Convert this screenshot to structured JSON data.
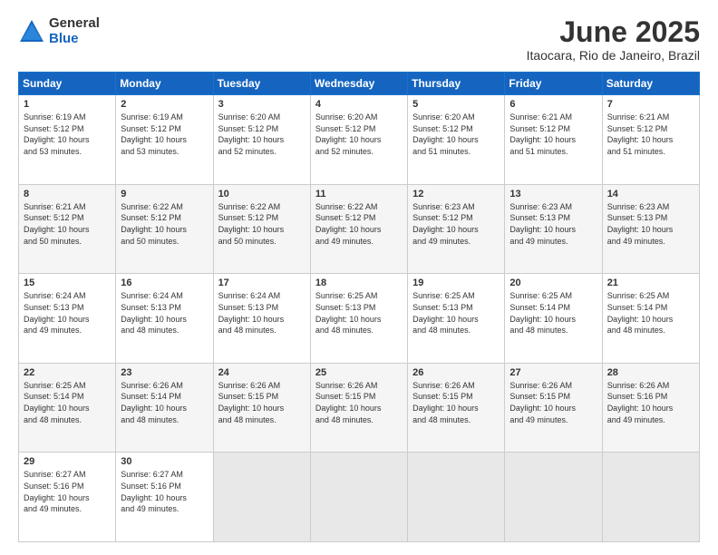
{
  "logo": {
    "general": "General",
    "blue": "Blue"
  },
  "title": "June 2025",
  "location": "Itaocara, Rio de Janeiro, Brazil",
  "days_of_week": [
    "Sunday",
    "Monday",
    "Tuesday",
    "Wednesday",
    "Thursday",
    "Friday",
    "Saturday"
  ],
  "weeks": [
    [
      {
        "day": "1",
        "info": "Sunrise: 6:19 AM\nSunset: 5:12 PM\nDaylight: 10 hours\nand 53 minutes."
      },
      {
        "day": "2",
        "info": "Sunrise: 6:19 AM\nSunset: 5:12 PM\nDaylight: 10 hours\nand 53 minutes."
      },
      {
        "day": "3",
        "info": "Sunrise: 6:20 AM\nSunset: 5:12 PM\nDaylight: 10 hours\nand 52 minutes."
      },
      {
        "day": "4",
        "info": "Sunrise: 6:20 AM\nSunset: 5:12 PM\nDaylight: 10 hours\nand 52 minutes."
      },
      {
        "day": "5",
        "info": "Sunrise: 6:20 AM\nSunset: 5:12 PM\nDaylight: 10 hours\nand 51 minutes."
      },
      {
        "day": "6",
        "info": "Sunrise: 6:21 AM\nSunset: 5:12 PM\nDaylight: 10 hours\nand 51 minutes."
      },
      {
        "day": "7",
        "info": "Sunrise: 6:21 AM\nSunset: 5:12 PM\nDaylight: 10 hours\nand 51 minutes."
      }
    ],
    [
      {
        "day": "8",
        "info": "Sunrise: 6:21 AM\nSunset: 5:12 PM\nDaylight: 10 hours\nand 50 minutes."
      },
      {
        "day": "9",
        "info": "Sunrise: 6:22 AM\nSunset: 5:12 PM\nDaylight: 10 hours\nand 50 minutes."
      },
      {
        "day": "10",
        "info": "Sunrise: 6:22 AM\nSunset: 5:12 PM\nDaylight: 10 hours\nand 50 minutes."
      },
      {
        "day": "11",
        "info": "Sunrise: 6:22 AM\nSunset: 5:12 PM\nDaylight: 10 hours\nand 49 minutes."
      },
      {
        "day": "12",
        "info": "Sunrise: 6:23 AM\nSunset: 5:12 PM\nDaylight: 10 hours\nand 49 minutes."
      },
      {
        "day": "13",
        "info": "Sunrise: 6:23 AM\nSunset: 5:13 PM\nDaylight: 10 hours\nand 49 minutes."
      },
      {
        "day": "14",
        "info": "Sunrise: 6:23 AM\nSunset: 5:13 PM\nDaylight: 10 hours\nand 49 minutes."
      }
    ],
    [
      {
        "day": "15",
        "info": "Sunrise: 6:24 AM\nSunset: 5:13 PM\nDaylight: 10 hours\nand 49 minutes."
      },
      {
        "day": "16",
        "info": "Sunrise: 6:24 AM\nSunset: 5:13 PM\nDaylight: 10 hours\nand 48 minutes."
      },
      {
        "day": "17",
        "info": "Sunrise: 6:24 AM\nSunset: 5:13 PM\nDaylight: 10 hours\nand 48 minutes."
      },
      {
        "day": "18",
        "info": "Sunrise: 6:25 AM\nSunset: 5:13 PM\nDaylight: 10 hours\nand 48 minutes."
      },
      {
        "day": "19",
        "info": "Sunrise: 6:25 AM\nSunset: 5:13 PM\nDaylight: 10 hours\nand 48 minutes."
      },
      {
        "day": "20",
        "info": "Sunrise: 6:25 AM\nSunset: 5:14 PM\nDaylight: 10 hours\nand 48 minutes."
      },
      {
        "day": "21",
        "info": "Sunrise: 6:25 AM\nSunset: 5:14 PM\nDaylight: 10 hours\nand 48 minutes."
      }
    ],
    [
      {
        "day": "22",
        "info": "Sunrise: 6:25 AM\nSunset: 5:14 PM\nDaylight: 10 hours\nand 48 minutes."
      },
      {
        "day": "23",
        "info": "Sunrise: 6:26 AM\nSunset: 5:14 PM\nDaylight: 10 hours\nand 48 minutes."
      },
      {
        "day": "24",
        "info": "Sunrise: 6:26 AM\nSunset: 5:15 PM\nDaylight: 10 hours\nand 48 minutes."
      },
      {
        "day": "25",
        "info": "Sunrise: 6:26 AM\nSunset: 5:15 PM\nDaylight: 10 hours\nand 48 minutes."
      },
      {
        "day": "26",
        "info": "Sunrise: 6:26 AM\nSunset: 5:15 PM\nDaylight: 10 hours\nand 48 minutes."
      },
      {
        "day": "27",
        "info": "Sunrise: 6:26 AM\nSunset: 5:15 PM\nDaylight: 10 hours\nand 49 minutes."
      },
      {
        "day": "28",
        "info": "Sunrise: 6:26 AM\nSunset: 5:16 PM\nDaylight: 10 hours\nand 49 minutes."
      }
    ],
    [
      {
        "day": "29",
        "info": "Sunrise: 6:27 AM\nSunset: 5:16 PM\nDaylight: 10 hours\nand 49 minutes."
      },
      {
        "day": "30",
        "info": "Sunrise: 6:27 AM\nSunset: 5:16 PM\nDaylight: 10 hours\nand 49 minutes."
      },
      {
        "day": "",
        "info": ""
      },
      {
        "day": "",
        "info": ""
      },
      {
        "day": "",
        "info": ""
      },
      {
        "day": "",
        "info": ""
      },
      {
        "day": "",
        "info": ""
      }
    ]
  ]
}
